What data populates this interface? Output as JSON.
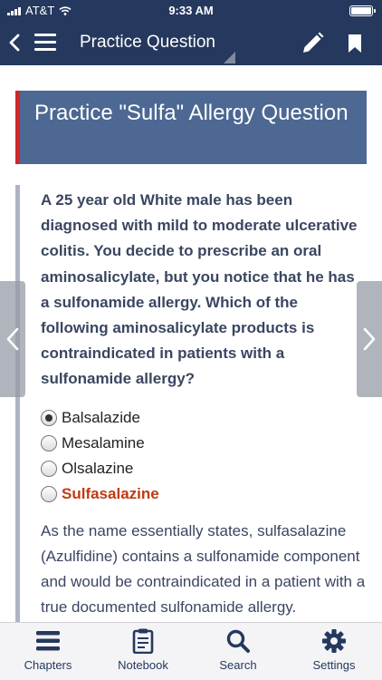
{
  "status_bar": {
    "carrier": "AT&T",
    "time": "9:33 AM"
  },
  "nav_bar": {
    "title": "Practice Question",
    "icons": [
      "back-chevron-icon",
      "menu-icon",
      "edit-pencil-icon",
      "bookmark-icon"
    ]
  },
  "page": {
    "title": "Practice \"Sulfa\" Allergy Question",
    "question": "A 25 year old White male has been diagnosed with mild to moderate ulcerative colitis. You decide to prescribe an oral aminosalicylate, but you notice that he has a sulfonamide allergy. Which of the following aminosalicylate products is contraindicated in patients with a sulfonamide allergy?",
    "options": [
      {
        "label": "Balsalazide",
        "selected": true
      },
      {
        "label": "Mesalamine",
        "selected": false
      },
      {
        "label": "Olsalazine",
        "selected": false
      },
      {
        "label": "Sulfasalazine",
        "selected": false,
        "correct": true
      }
    ],
    "explanation": "As the name essentially states, sulfasalazine (Azulfidine) contains a sulfonamide component and would be contraindicated in a patient with a true documented sulfonamide allergy. Sulfasalazine is"
  },
  "tabs": [
    {
      "label": "Chapters",
      "icon": "list-icon"
    },
    {
      "label": "Notebook",
      "icon": "clipboard-icon"
    },
    {
      "label": "Search",
      "icon": "search-icon"
    },
    {
      "label": "Settings",
      "icon": "gear-icon"
    }
  ],
  "colors": {
    "nav": "#25385e",
    "title_box": "#4c6893",
    "title_accent": "#d0262c",
    "correct_answer": "#bf3a12",
    "question_text": "#3a4661"
  }
}
